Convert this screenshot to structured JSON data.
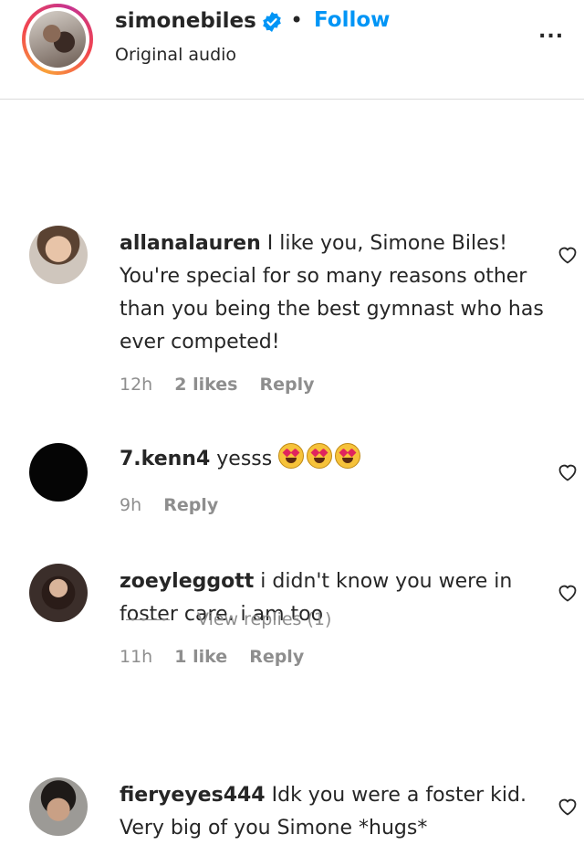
{
  "post_header": {
    "username": "simonebiles",
    "separator": "•",
    "follow_label": "Follow",
    "audio_label": "Original audio",
    "more_label": "..."
  },
  "comments": [
    {
      "username": "allanalauren",
      "text": "I like you, Simone Biles! You're special for so many reasons other than you being the best gymnast who has ever competed!",
      "time": "12h",
      "likes": "2 likes",
      "reply_label": "Reply"
    },
    {
      "username": "7.kenn4",
      "text": "yesss",
      "emojis": [
        "star-struck-emoji",
        "star-struck-emoji",
        "star-struck-emoji"
      ],
      "time": "9h",
      "reply_label": "Reply"
    },
    {
      "username": "zoeyleggott",
      "text": "i didn't know you were in foster care. i am too",
      "time": "11h",
      "likes": "1 like",
      "reply_label": "Reply",
      "view_replies_label": "View replies (1)"
    },
    {
      "username": "fieryeyes444",
      "text": "Idk you were a foster kid. Very big of you Simone *hugs*"
    }
  ],
  "colors": {
    "follow_blue": "#0095f6",
    "verified_blue": "#0095f6",
    "muted_text": "#8e8e8e",
    "primary_text": "#262626"
  }
}
